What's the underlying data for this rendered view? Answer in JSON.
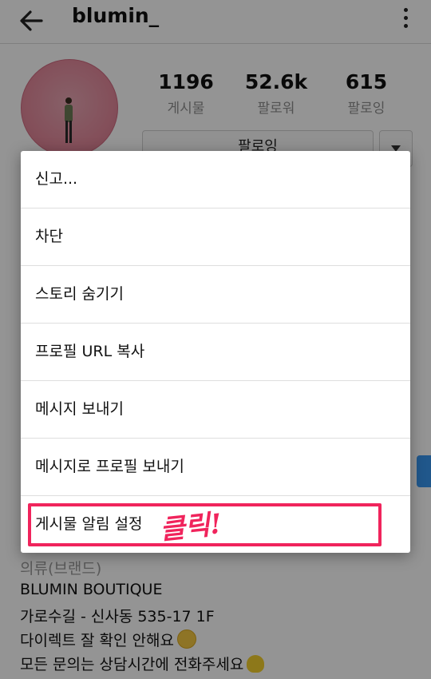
{
  "header": {
    "title": "blumin_"
  },
  "profile": {
    "stats": [
      {
        "value": "1196",
        "label": "게시물"
      },
      {
        "value": "52.6k",
        "label": "팔로워"
      },
      {
        "value": "615",
        "label": "팔로잉"
      }
    ],
    "follow_button": "팔로잉"
  },
  "bio": {
    "lines": [
      "의류(브랜드)",
      "BLUMIN BOUTIQUE",
      "가로수길 - 신사동 535-17 1F",
      "다이렉트 잘 확인 안해요",
      "모든 문의는 상담시간에 전화주세요"
    ]
  },
  "menu": {
    "items": [
      "신고...",
      "차단",
      "스토리 숨기기",
      "프로필 URL 복사",
      "메시지 보내기",
      "메시지로 프로필 보내기",
      "게시물 알림 설정"
    ]
  },
  "annotation": {
    "text": "클릭!",
    "color": "#f0245c"
  }
}
